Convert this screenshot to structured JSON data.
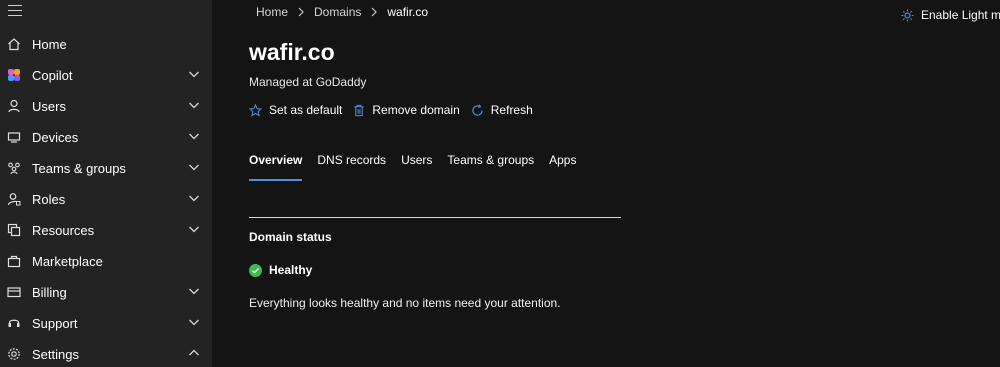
{
  "sidebar": {
    "items": [
      {
        "label": "Home",
        "icon": "home-icon",
        "has_chevron": false
      },
      {
        "label": "Copilot",
        "icon": "copilot-icon",
        "has_chevron": true,
        "chevron": "down"
      },
      {
        "label": "Users",
        "icon": "user-icon",
        "has_chevron": true,
        "chevron": "down"
      },
      {
        "label": "Devices",
        "icon": "device-icon",
        "has_chevron": true,
        "chevron": "down"
      },
      {
        "label": "Teams & groups",
        "icon": "teams-icon",
        "has_chevron": true,
        "chevron": "down"
      },
      {
        "label": "Roles",
        "icon": "roles-icon",
        "has_chevron": true,
        "chevron": "down"
      },
      {
        "label": "Resources",
        "icon": "resources-icon",
        "has_chevron": true,
        "chevron": "down"
      },
      {
        "label": "Marketplace",
        "icon": "marketplace-icon",
        "has_chevron": false
      },
      {
        "label": "Billing",
        "icon": "billing-icon",
        "has_chevron": true,
        "chevron": "down"
      },
      {
        "label": "Support",
        "icon": "support-icon",
        "has_chevron": true,
        "chevron": "down"
      },
      {
        "label": "Settings",
        "icon": "gear-icon",
        "has_chevron": true,
        "chevron": "up"
      }
    ]
  },
  "breadcrumb": {
    "home": "Home",
    "domains": "Domains",
    "current": "wafir.co"
  },
  "header": {
    "light_mode_label": "Enable Light mo"
  },
  "page": {
    "title": "wafir.co",
    "subtitle": "Managed at GoDaddy"
  },
  "actions": {
    "set_default": "Set as default",
    "remove_domain": "Remove domain",
    "refresh": "Refresh"
  },
  "tabs": [
    {
      "label": "Overview",
      "active": true
    },
    {
      "label": "DNS records",
      "active": false
    },
    {
      "label": "Users",
      "active": false
    },
    {
      "label": "Teams & groups",
      "active": false
    },
    {
      "label": "Apps",
      "active": false
    }
  ],
  "domain_status": {
    "title": "Domain status",
    "status": "Healthy",
    "description": "Everything looks healthy and no items need your attention."
  },
  "colors": {
    "accent": "#4f8fe0",
    "healthy": "#3fb950",
    "sidebar_bg": "#232323",
    "page_bg": "#141414"
  }
}
